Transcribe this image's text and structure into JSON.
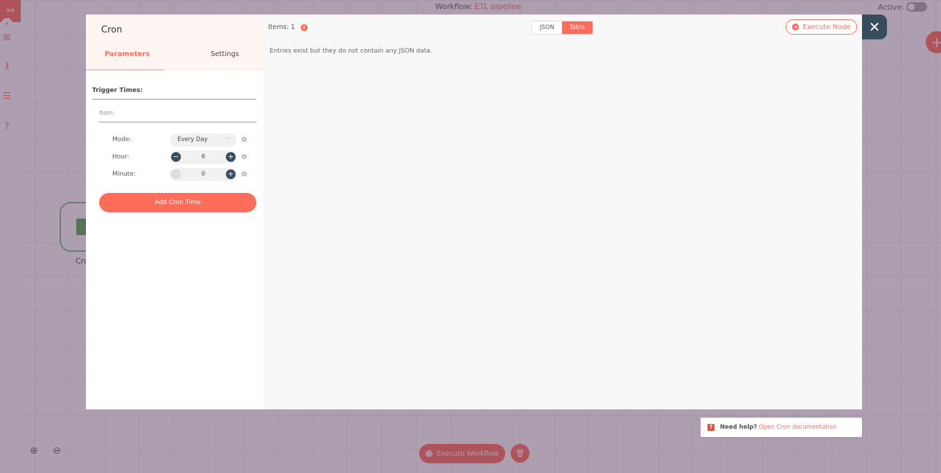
{
  "app": {
    "workflow_label": "Workflow:",
    "workflow_name": "ETL pipeline",
    "active_label": "Active:",
    "active": false,
    "node_label": "Cron",
    "execute_workflow_label": "Execute Workflow",
    "icons": {
      "logo": "workflow-logo-icon",
      "expand": "chevron-right-icon",
      "sidebar": [
        "network-icon",
        "key-icon",
        "list-icon",
        "question-icon"
      ],
      "zoom_in": "zoom-in-icon",
      "zoom_out": "zoom-out-icon",
      "add_node": "plus-icon",
      "delete": "trash-icon"
    }
  },
  "dialog": {
    "node_title": "Cron",
    "tabs": [
      {
        "label": "Parameters",
        "active": true
      },
      {
        "label": "Settings",
        "active": false
      }
    ],
    "parameters": {
      "section_label": "Trigger Times:",
      "item_label": "Item:",
      "fields": {
        "mode": {
          "label": "Mode:",
          "value": "Every Day"
        },
        "hour": {
          "label": "Hour:",
          "value": "6"
        },
        "minute": {
          "label": "Minute:",
          "value": "0"
        }
      },
      "add_button": "Add Cron Time"
    },
    "output": {
      "items_label": "Items: 1",
      "view_options": [
        {
          "label": "JSON",
          "active": false
        },
        {
          "label": "Table",
          "active": true
        }
      ],
      "execute_node_label": "Execute Node",
      "message": "Entries exist but they do not contain any JSON data."
    },
    "help": {
      "prefix": "Need help?",
      "link": "Open Cron documentation"
    }
  },
  "colors": {
    "accent": "#ff6d5a",
    "dark": "#374c5d"
  }
}
